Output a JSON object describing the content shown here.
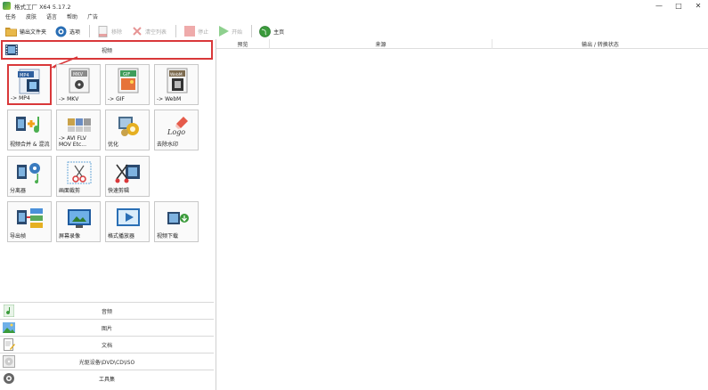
{
  "window": {
    "title": "格式工厂 X64 5.17.2",
    "controls": {
      "minimize": "—",
      "maximize": "□",
      "close": "✕"
    }
  },
  "menu": [
    "任务",
    "皮肤",
    "语言",
    "帮助",
    "广告"
  ],
  "toolbar": {
    "output_folder": "输出文件夹",
    "options": "选项",
    "remove": "移除",
    "clear_list": "清空列表",
    "stop": "停止",
    "start": "开始",
    "home": "主页"
  },
  "categories": {
    "video": "视频",
    "audio": "音频",
    "image": "图片",
    "document": "文档",
    "rom": "光驱设备\\DVD\\CD\\ISO",
    "tools": "工具集"
  },
  "tiles": [
    {
      "label": "-> MP4",
      "badge": "MP4"
    },
    {
      "label": "-> MKV",
      "badge": "MKV"
    },
    {
      "label": "-> GIF",
      "badge": "GIF"
    },
    {
      "label": "-> WebM",
      "badge": "WebM"
    },
    {
      "label": "视频合并 & 混流"
    },
    {
      "label": "-> AVI FLV\nMOV Etc..."
    },
    {
      "label": "优化"
    },
    {
      "label": "分离器"
    },
    {
      "label": "画面裁剪"
    },
    {
      "label": "快速剪辑"
    },
    {
      "label": "去除水印",
      "badge": "Logo"
    },
    {
      "label": "导出帧"
    },
    {
      "label": "屏幕录像"
    },
    {
      "label": "格式播放器"
    },
    {
      "label": "视频下载"
    }
  ],
  "table": {
    "headers": [
      "预览",
      "来源",
      "输出 / 转换状态"
    ]
  },
  "colors": {
    "highlight_border": "#d9383a",
    "panel_divider": "#d0d0d0"
  }
}
